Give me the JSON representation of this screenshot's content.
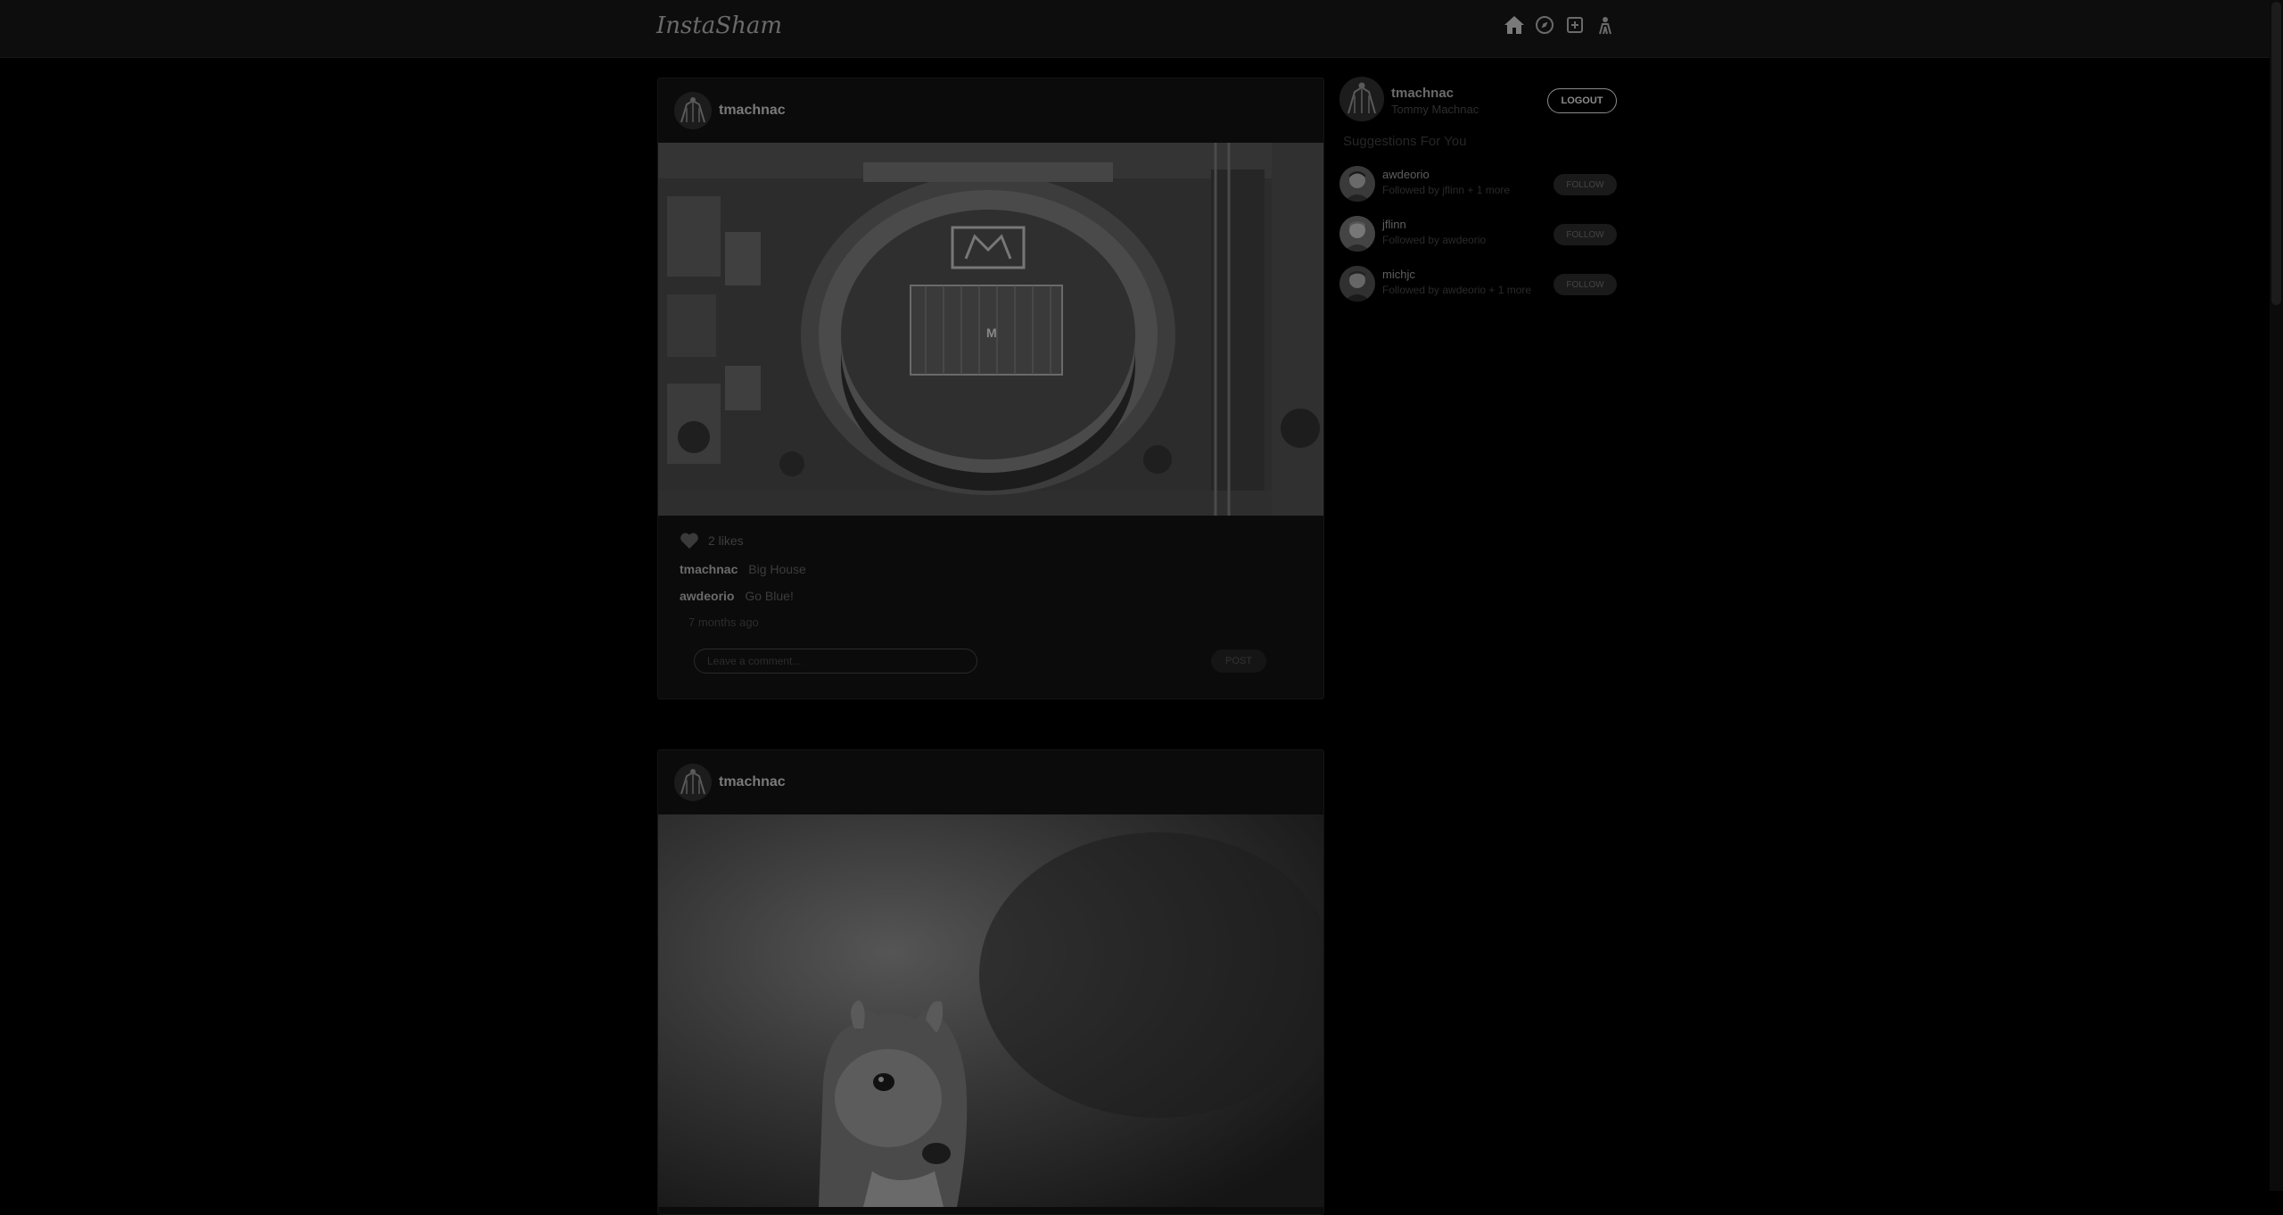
{
  "header": {
    "logo": "InstaSham",
    "icons": [
      "home-icon",
      "explore-icon",
      "create-post-icon",
      "profile-icon"
    ]
  },
  "posts": [
    {
      "user": "tmachnac",
      "image": "aerial-stadium-photo",
      "likes": "2 likes",
      "comments": [
        {
          "user": "tmachnac",
          "text": "Big House"
        },
        {
          "user": "awdeorio",
          "text": "Go Blue!"
        }
      ],
      "timestamp": "7 months ago",
      "comment_placeholder": "Leave a comment...",
      "post_label": "POST"
    },
    {
      "user": "tmachnac",
      "image": "squirrel-photo"
    }
  ],
  "sidebar": {
    "user": "tmachnac",
    "name": "Tommy Machnac",
    "logout_label": "LOGOUT",
    "suggestions_title": "Suggestions For You",
    "suggestions": [
      {
        "user": "awdeorio",
        "sub": "Followed by jflinn + 1 more",
        "follow_label": "FOLLOW"
      },
      {
        "user": "jflinn",
        "sub": "Followed by awdeorio",
        "follow_label": "FOLLOW"
      },
      {
        "user": "michjc",
        "sub": "Followed by awdeorio + 1 more",
        "follow_label": "FOLLOW"
      }
    ]
  },
  "colors": {
    "background": "#000000",
    "card": "#0b0b0b",
    "topbar": "#0d0d0d"
  }
}
